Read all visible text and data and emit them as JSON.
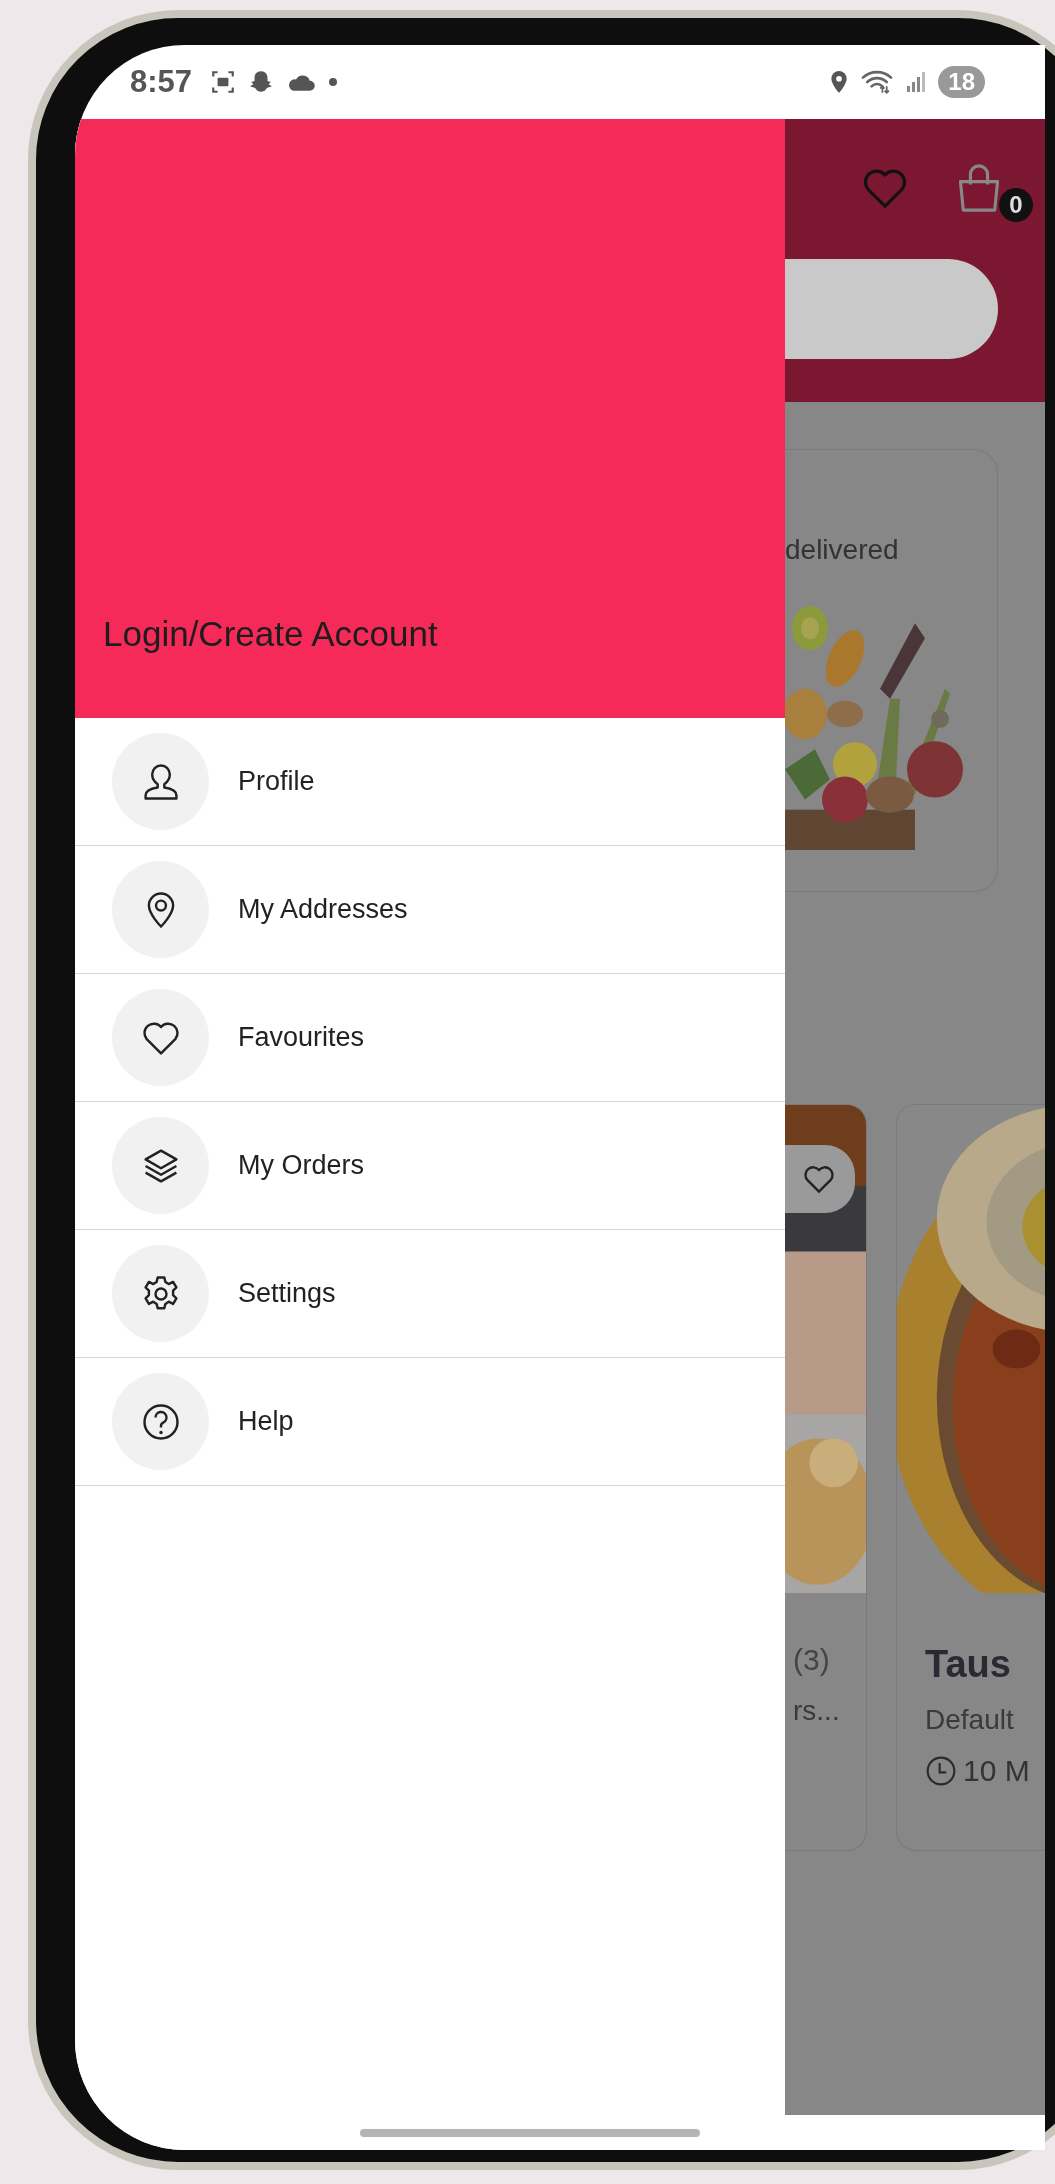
{
  "status_bar": {
    "time": "8:57",
    "battery": "18"
  },
  "drawer": {
    "header": {
      "login_label": "Login/Create Account"
    },
    "items": [
      {
        "label": "Profile",
        "kind": "person"
      },
      {
        "label": "My Addresses",
        "kind": "pin"
      },
      {
        "label": "Favourites",
        "kind": "heart"
      },
      {
        "label": "My Orders",
        "kind": "layers"
      },
      {
        "label": "Settings",
        "kind": "gear"
      },
      {
        "label": "Help",
        "kind": "help"
      }
    ]
  },
  "background": {
    "cart_count": "0",
    "promo_card": {
      "subtitle": "delivered"
    },
    "products": [
      {
        "rating_count": "(3)",
        "subtitle": "rs..."
      },
      {
        "name": "Taus",
        "subtitle": "Default",
        "delivery_time": "10 M"
      }
    ]
  }
}
